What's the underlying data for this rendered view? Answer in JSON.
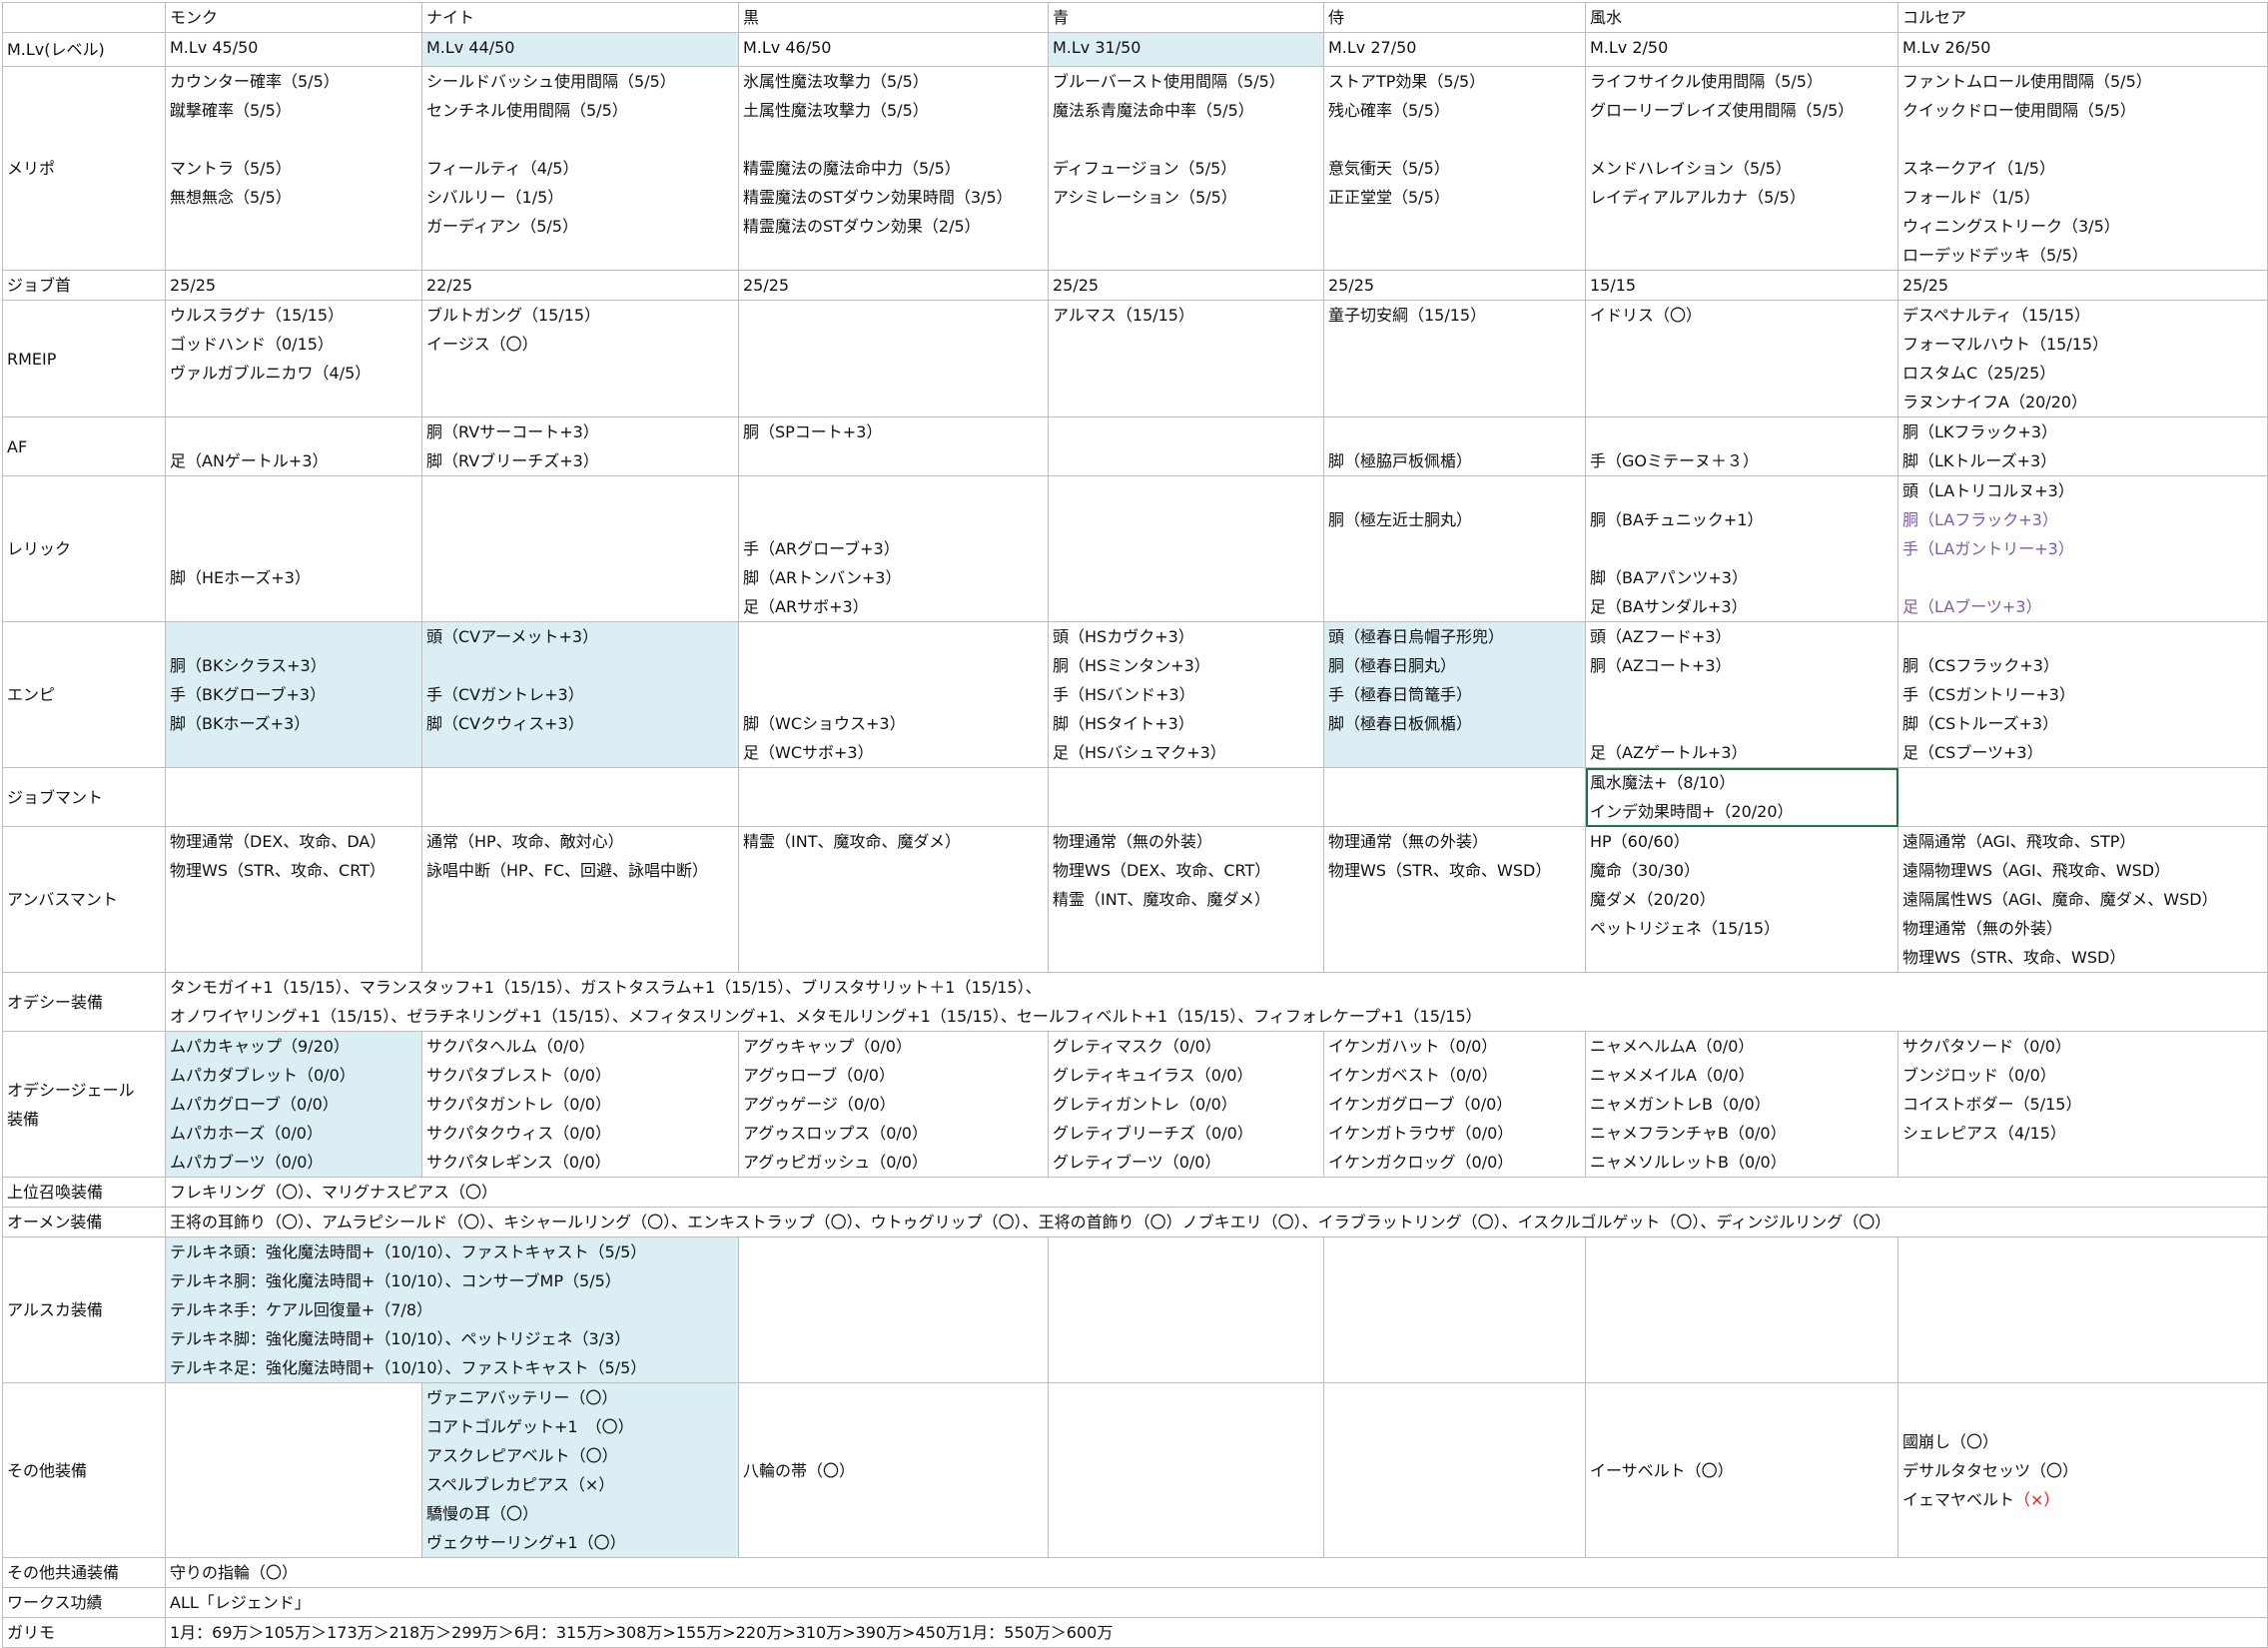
{
  "header": {
    "jobs": [
      "モンク",
      "ナイト",
      "黒",
      "青",
      "侍",
      "風水",
      "コルセア"
    ]
  },
  "rows": {
    "mlv": {
      "label": "M.Lv(レベル)",
      "cells": [
        "M.Lv 45/50",
        "M.Lv 44/50",
        "M.Lv 46/50",
        "M.Lv 31/50",
        "M.Lv 27/50",
        "M.Lv 2/50",
        "M.Lv 26/50"
      ]
    },
    "merit": {
      "label": "メリポ",
      "cells": [
        [
          "カウンター確率（5/5）",
          "蹴撃確率（5/5）",
          "",
          "マントラ（5/5）",
          "無想無念（5/5）"
        ],
        [
          "シールドバッシュ使用間隔（5/5）",
          "センチネル使用間隔（5/5）",
          "",
          "フィールティ（4/5）",
          "シバルリー（1/5）",
          "ガーディアン（5/5）"
        ],
        [
          "氷属性魔法攻撃力（5/5）",
          "土属性魔法攻撃力（5/5）",
          "",
          "精霊魔法の魔法命中力（5/5）",
          "精霊魔法のSTダウン効果時間（3/5）",
          "精霊魔法のSTダウン効果（2/5）"
        ],
        [
          "ブルーバースト使用間隔（5/5）",
          "魔法系青魔法命中率（5/5）",
          "",
          "ディフュージョン（5/5）",
          "アシミレーション（5/5）"
        ],
        [
          "ストアTP効果（5/5）",
          "残心確率（5/5）",
          "",
          "意気衝天（5/5）",
          "正正堂堂（5/5）"
        ],
        [
          "ライフサイクル使用間隔（5/5）",
          "グローリーブレイズ使用間隔（5/5）",
          "",
          "メンドハレイション（5/5）",
          "レイディアルアルカナ（5/5）"
        ],
        [
          "ファントムロール使用間隔（5/5）",
          "クイックドロー使用間隔（5/5）",
          "",
          "スネークアイ（1/5）",
          "フォールド（1/5）",
          "ウィニングストリーク（3/5）",
          "ローデッドデッキ（5/5）"
        ]
      ]
    },
    "jobpoints": {
      "label": "ジョブ首",
      "cells": [
        "25/25",
        "22/25",
        "25/25",
        "25/25",
        "25/25",
        "15/15",
        "25/25"
      ]
    },
    "rmeip": {
      "label": "RMEIP",
      "cells": [
        [
          "ウルスラグナ（15/15）",
          "ゴッドハンド（0/15）",
          "ヴァルガブルニカワ（4/5）"
        ],
        [
          "ブルトガング（15/15）",
          "イージス（〇）"
        ],
        [],
        [
          "アルマス（15/15）"
        ],
        [
          "童子切安綱（15/15）"
        ],
        [
          "イドリス（〇）"
        ],
        [
          "デスペナルティ（15/15）",
          "フォーマルハウト（15/15）",
          "ロスタムC（25/25）",
          "ラヌンナイフA（20/20）"
        ]
      ]
    },
    "af": {
      "label": "AF",
      "cells": [
        [
          "",
          "足（ANゲートル+3）"
        ],
        [
          "胴（RVサーコート+3）",
          "脚（RVブリーチズ+3）"
        ],
        [
          "胴（SPコート+3）"
        ],
        [],
        [
          "",
          "脚（極脇戸板佩楯）"
        ],
        [
          "",
          "手（GOミテーヌ＋３）"
        ],
        [
          "胴（LKフラック+3）",
          "脚（LKトルーズ+3）"
        ]
      ]
    },
    "relic": {
      "label": "レリック",
      "cells": [
        [
          "",
          "",
          "",
          "脚（HEホーズ+3）"
        ],
        [],
        [
          "",
          "",
          "手（ARグローブ+3）",
          "脚（ARトンバン+3）",
          "足（ARサボ+3）"
        ],
        [],
        [
          "",
          "胴（極左近士胴丸）"
        ],
        [
          "",
          "胴（BAチュニック+1）",
          "",
          "脚（BAアパンツ+3）",
          "足（BAサンダル+3）"
        ],
        [
          "頭（LAトリコルヌ+3）",
          "胴（LAフラック+3）",
          "手（LAガントリー+3）",
          "",
          "足（LAブーツ+3）"
        ]
      ]
    },
    "empy": {
      "label": "エンピ",
      "cells": [
        [
          "",
          "胴（BKシクラス+3）",
          "手（BKグローブ+3）",
          "脚（BKホーズ+3）"
        ],
        [
          "頭（CVアーメット+3）",
          "",
          "手（CVガントレ+3）",
          "脚（CVクウィス+3）"
        ],
        [
          "",
          "",
          "",
          "脚（WCショウス+3）",
          "足（WCサボ+3）"
        ],
        [
          "頭（HSカヴク+3）",
          "胴（HSミンタン+3）",
          "手（HSバンド+3）",
          "脚（HSタイト+3）",
          "足（HSバシュマク+3）"
        ],
        [
          "頭（極春日烏帽子形兜）",
          "胴（極春日胴丸）",
          "手（極春日筒篭手）",
          "脚（極春日板佩楯）"
        ],
        [
          "頭（AZフード+3）",
          "胴（AZコート+3）",
          "",
          "",
          "足（AZゲートル+3）"
        ],
        [
          "",
          "胴（CSフラック+3）",
          "手（CSガントリー+3）",
          "脚（CSトルーズ+3）",
          "足（CSブーツ+3）"
        ]
      ]
    },
    "mantle": {
      "label": "ジョブマント",
      "cells": [
        [],
        [],
        [],
        [],
        [],
        [
          "風水魔法+（8/10）",
          "インデ効果時間+（20/20）"
        ],
        []
      ]
    },
    "ambu": {
      "label": "アンバスマント",
      "cells": [
        [
          "物理通常（DEX、攻命、DA）",
          "物理WS（STR、攻命、CRT）"
        ],
        [
          "通常（HP、攻命、敵対心）",
          "詠唱中断（HP、FC、回避、詠唱中断）"
        ],
        [
          "精霊（INT、魔攻命、魔ダメ）"
        ],
        [
          "物理通常（無の外装）",
          "物理WS（DEX、攻命、CRT）",
          "精霊（INT、魔攻命、魔ダメ）"
        ],
        [
          "物理通常（無の外装）",
          "物理WS（STR、攻命、WSD）"
        ],
        [
          "HP（60/60）",
          "魔命（30/30）",
          "魔ダメ（20/20）",
          "ペットリジェネ（15/15）"
        ],
        [
          "遠隔通常（AGI、飛攻命、STP）",
          "遠隔物理WS（AGI、飛攻命、WSD）",
          "遠隔属性WS（AGI、魔命、魔ダメ、WSD）",
          "物理通常（無の外装）",
          "物理WS（STR、攻命、WSD）"
        ]
      ]
    },
    "odyssey": {
      "label": "オデシー装備",
      "lines": [
        "タンモガイ+1（15/15）、マランスタッフ+1（15/15）、ガストタスラム+1（15/15）、ブリスタサリット＋1（15/15）、",
        "オノワイヤリング+1（15/15）、ゼラチネリング+1（15/15）、メフィタスリング+1、メタモルリング+1（15/15）、セールフィベルト+1（15/15）、フィフォレケープ+1（15/15）"
      ]
    },
    "sheol": {
      "label_lines": [
        "オデシージェール",
        "装備"
      ],
      "cells": [
        [
          "ムパカキャップ（9/20）",
          "ムパカダブレット（0/0）",
          "ムパカグローブ（0/0）",
          "ムパカホーズ（0/0）",
          "ムパカブーツ（0/0）"
        ],
        [
          "サクパタヘルム（0/0）",
          "サクパタブレスト（0/0）",
          "サクパタガントレ（0/0）",
          "サクパタクウィス（0/0）",
          "サクパタレギンス（0/0）"
        ],
        [
          "アグゥキャップ（0/0）",
          "アグゥローブ（0/0）",
          "アグゥゲージ（0/0）",
          "アグゥスロップス（0/0）",
          "アグゥピガッシュ（0/0）"
        ],
        [
          "グレティマスク（0/0）",
          "グレティキュイラス（0/0）",
          "グレティガントレ（0/0）",
          "グレティブリーチズ（0/0）",
          "グレティブーツ（0/0）"
        ],
        [
          "イケンガハット（0/0）",
          "イケンガベスト（0/0）",
          "イケンガグローブ（0/0）",
          "イケンガトラウザ（0/0）",
          "イケンガクロッグ（0/0）"
        ],
        [
          "ニャメヘルムA（0/0）",
          "ニャメメイルA（0/0）",
          "ニャメガントレB（0/0）",
          "ニャメフランチャB（0/0）",
          "ニャメソルレットB（0/0）"
        ],
        [
          "サクパタソード（0/0）",
          "ブンジロッド（0/0）",
          "コイストボダー（5/15）",
          "シェレピアス（4/15）"
        ]
      ]
    },
    "summon": {
      "label": "上位召喚装備",
      "text": "フレキリング（〇）、マリグナスピアス（〇）"
    },
    "omen": {
      "label": "オーメン装備",
      "text": "王将の耳飾り（〇）、アムラピシールド（〇）、キシャールリング（〇）、エンキストラップ（〇）、ウトゥグリップ（〇）、王将の首飾り（〇）ノブキエリ（〇）、イラブラットリング（〇）、イスクルゴルゲット（〇）、ディンジルリング（〇）"
    },
    "aeonic": {
      "label": "アルスカ装備",
      "lines": [
        "テルキネ頭：強化魔法時間+（10/10）、ファストキャスト（5/5）",
        "テルキネ胴：強化魔法時間+（10/10）、コンサーブMP（5/5）",
        "テルキネ手：ケアル回復量+（7/8）",
        "テルキネ脚：強化魔法時間+（10/10）、ペットリジェネ（3/3）",
        "テルキネ足：強化魔法時間+（10/10）、ファストキャスト（5/5）"
      ]
    },
    "other": {
      "label": "その他装備",
      "knight": [
        "ヴァニアバッテリー（〇）",
        "コアトゴルゲット+1　（〇）",
        "アスクレピアベルト（〇）",
        "スペルブレカピアス（×）",
        "驕慢の耳（〇）",
        "ヴェクサーリング+1（〇）"
      ],
      "black": "八輪の帯（〇）",
      "geo": "イーサベルト（〇）",
      "cor": [
        "國崩し（〇）",
        "デサルタタセッツ（〇）"
      ],
      "cor_last_text": "イェマヤベルト",
      "cor_last_mark": "（×）"
    },
    "common": {
      "label": "その他共通装備",
      "text": "守りの指輪（〇）"
    },
    "works": {
      "label": "ワークス功績",
      "text": "ALL「レジェンド」"
    },
    "gallimaufry": {
      "label": "ガリモ",
      "text": "1月：69万＞105万＞173万＞218万＞299万＞6月：315万>308万>155万>220万>310万>390万>450万1月：550万＞600万"
    }
  },
  "colors": {
    "highlight": "#daeef3",
    "grid": "#bdbdbd",
    "selection": "#217346",
    "purple_text": "#7f5aa2",
    "red_text": "#e02020"
  }
}
